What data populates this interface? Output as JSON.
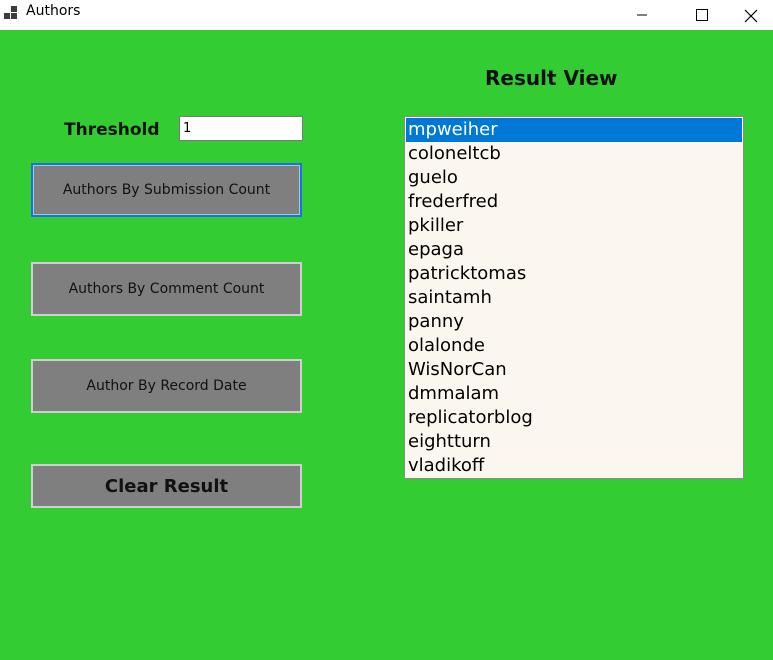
{
  "window": {
    "title": "Authors",
    "controls": [
      "minimize-icon",
      "maximize-icon",
      "close-icon"
    ]
  },
  "colors": {
    "background": "#33cc33",
    "button": "#7f7f7f",
    "list_background": "#fcf7ee",
    "selection": "#0078d7"
  },
  "form": {
    "threshold_label": "Threshold",
    "threshold_value": "1",
    "buttons": {
      "submission": "Authors By Submission Count",
      "comment": "Authors By Comment Count",
      "record_date": "Author By Record Date",
      "clear": "Clear Result"
    }
  },
  "result": {
    "title": "Result View",
    "selected_index": 0,
    "items": [
      "mpweiher",
      "coloneltcb",
      "guelo",
      "frederfred",
      "pkiller",
      "epaga",
      "patricktomas",
      "saintamh",
      "panny",
      "olalonde",
      "WisNorCan",
      "dmmalam",
      "replicatorblog",
      "eightturn",
      "vladikoff"
    ]
  }
}
